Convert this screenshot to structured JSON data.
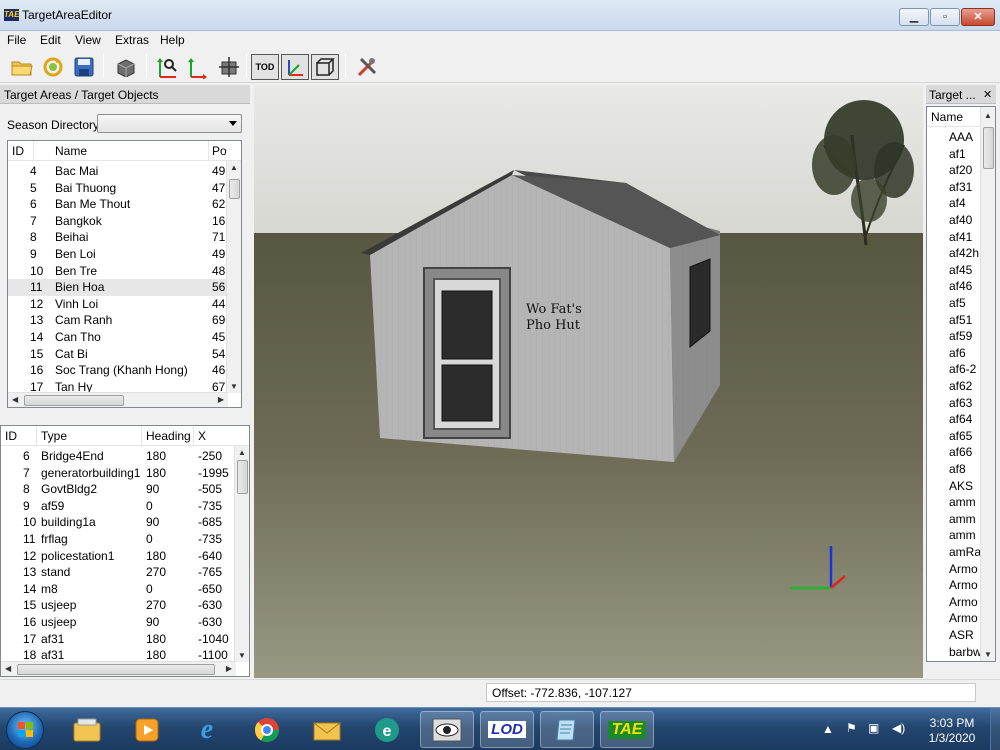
{
  "window": {
    "title": "TargetAreaEditor",
    "app_icon_text": "TAE",
    "minimize_glyph": "▁",
    "maximize_glyph": "▫",
    "close_glyph": "✕"
  },
  "menu": [
    "File",
    "Edit",
    "View",
    "Extras",
    "Help"
  ],
  "toolbar": {
    "icons": [
      "open-folder-icon",
      "refresh-icon",
      "save-icon",
      "cube-icon",
      "find-object-icon",
      "move-axes-icon",
      "crosshair-icon",
      "tod-icon",
      "axes-toggle-icon",
      "box-toggle-icon",
      "tools-icon"
    ],
    "tod_label": "TOD"
  },
  "left_panel": {
    "title": "Target Areas / Target Objects",
    "season_label": "Season Directory:",
    "season_value": "",
    "areas_columns": [
      "ID",
      "Name",
      "Po"
    ],
    "areas_rows": [
      {
        "id": "4",
        "name": "Bac Mai",
        "po": "49"
      },
      {
        "id": "5",
        "name": "Bai Thuong",
        "po": "47"
      },
      {
        "id": "6",
        "name": "Ban Me Thout",
        "po": "62"
      },
      {
        "id": "7",
        "name": "Bangkok",
        "po": "16"
      },
      {
        "id": "8",
        "name": "Beihai",
        "po": "71"
      },
      {
        "id": "9",
        "name": "Ben Loi",
        "po": "49"
      },
      {
        "id": "10",
        "name": "Ben Tre",
        "po": "48"
      },
      {
        "id": "11",
        "name": "Bien Hoa",
        "po": "56"
      },
      {
        "id": "12",
        "name": "Vinh Loi",
        "po": "44"
      },
      {
        "id": "13",
        "name": "Cam Ranh",
        "po": "69"
      },
      {
        "id": "14",
        "name": "Can Tho",
        "po": "45"
      },
      {
        "id": "15",
        "name": "Cat Bi",
        "po": "54"
      },
      {
        "id": "16",
        "name": "Soc Trang (Khanh Hong)",
        "po": "46"
      },
      {
        "id": "17",
        "name": "Tan Hy",
        "po": "67"
      }
    ],
    "selected_area_index": 7,
    "objects_columns": [
      "ID",
      "Type",
      "Heading",
      "X"
    ],
    "objects_rows": [
      {
        "id": "6",
        "type": "Bridge4End",
        "heading": "180",
        "x": "-250"
      },
      {
        "id": "7",
        "type": "generatorbuilding1",
        "heading": "180",
        "x": "-1995"
      },
      {
        "id": "8",
        "type": "GovtBldg2",
        "heading": "90",
        "x": "-505"
      },
      {
        "id": "9",
        "type": "af59",
        "heading": "0",
        "x": "-735"
      },
      {
        "id": "10",
        "type": "building1a",
        "heading": "90",
        "x": "-685"
      },
      {
        "id": "11",
        "type": "frflag",
        "heading": "0",
        "x": "-735"
      },
      {
        "id": "12",
        "type": "policestation1",
        "heading": "180",
        "x": "-640"
      },
      {
        "id": "13",
        "type": "stand",
        "heading": "270",
        "x": "-765"
      },
      {
        "id": "14",
        "type": "m8",
        "heading": "0",
        "x": "-650"
      },
      {
        "id": "15",
        "type": "usjeep",
        "heading": "270",
        "x": "-630"
      },
      {
        "id": "16",
        "type": "usjeep",
        "heading": "90",
        "x": "-630"
      },
      {
        "id": "17",
        "type": "af31",
        "heading": "180",
        "x": "-1040"
      },
      {
        "id": "18",
        "type": "af31",
        "heading": "180",
        "x": "-1100"
      }
    ]
  },
  "viewport": {
    "sign_line1": "Wo Fat's",
    "sign_line2": "Pho Hut"
  },
  "right_panel": {
    "title": "Target ...",
    "close_glyph": "✕",
    "column": "Name",
    "items": [
      "AAA",
      "af1",
      "af20",
      "af31",
      "af4",
      "af40",
      "af41",
      "af42h",
      "af45",
      "af46",
      "af5",
      "af51",
      "af59",
      "af6",
      "af6-2",
      "af62",
      "af63",
      "af64",
      "af65",
      "af66",
      "af8",
      "AKS",
      "amm",
      "amm",
      "amm",
      "amRa",
      "Armo",
      "Armo",
      "Armo",
      "Armo",
      "ASR",
      "barbw"
    ]
  },
  "status": {
    "offset": "Offset: -772.836, -107.127"
  },
  "taskbar": {
    "apps": [
      "explorer-icon",
      "media-player-icon",
      "ie-icon",
      "chrome-icon",
      "mail-icon",
      "eset-icon",
      "eye-icon",
      "lod-icon",
      "notepad-icon",
      "tae-icon"
    ],
    "lod_label": "LOD",
    "tae_label": "TAE",
    "time": "3:03 PM",
    "date": "1/3/2020"
  }
}
